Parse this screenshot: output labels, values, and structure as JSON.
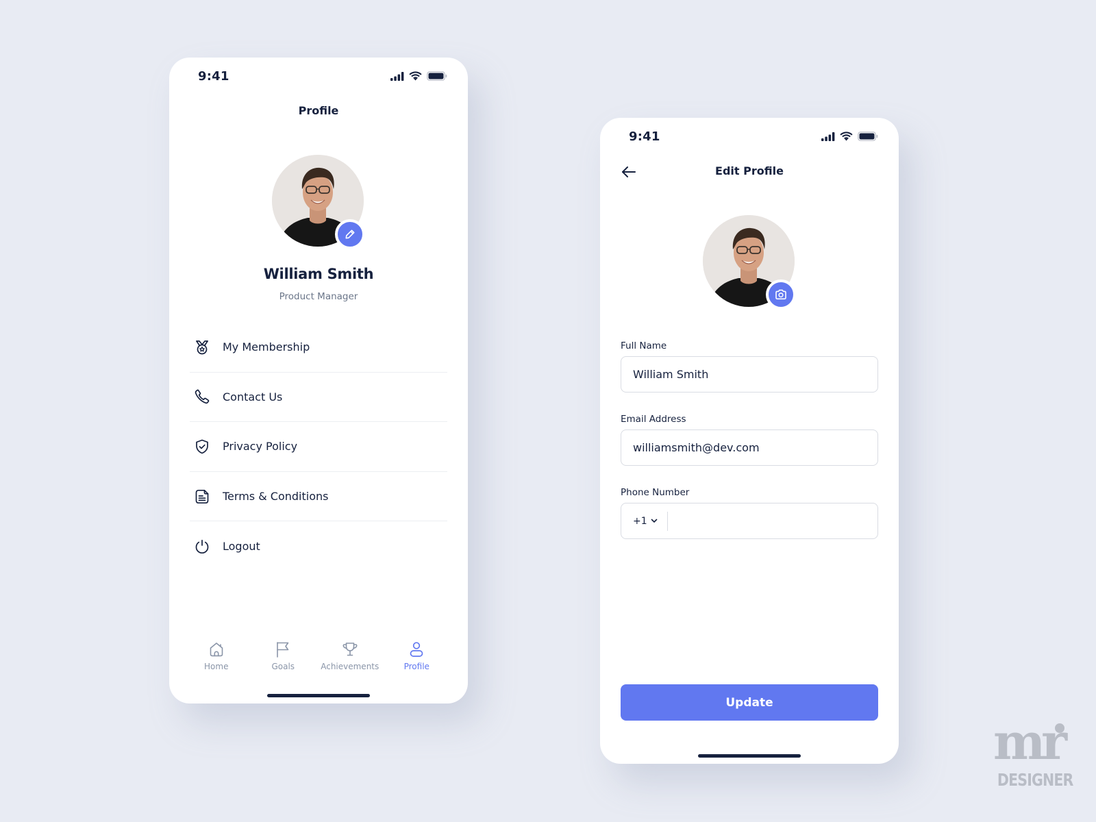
{
  "profile_screen": {
    "status_bar": {
      "time": "9:41"
    },
    "title": "Profile",
    "user": {
      "name": "William Smith",
      "role": "Product Manager"
    },
    "menu": [
      {
        "label": "My Membership",
        "icon": "medal-icon"
      },
      {
        "label": "Contact Us",
        "icon": "phone-icon"
      },
      {
        "label": "Privacy Policy",
        "icon": "shield-check-icon"
      },
      {
        "label": "Terms & Conditions",
        "icon": "document-icon"
      },
      {
        "label": "Logout",
        "icon": "power-icon"
      }
    ],
    "tabbar": [
      {
        "label": "Home",
        "icon": "home-icon",
        "active": false
      },
      {
        "label": "Goals",
        "icon": "flag-icon",
        "active": false
      },
      {
        "label": "Achievements",
        "icon": "trophy-icon",
        "active": false
      },
      {
        "label": "Profile",
        "icon": "user-icon",
        "active": true
      }
    ]
  },
  "edit_profile_screen": {
    "status_bar": {
      "time": "9:41"
    },
    "title": "Edit Profile",
    "fields": {
      "full_name": {
        "label": "Full Name",
        "value": "William Smith"
      },
      "email": {
        "label": "Email Address",
        "value": "williamsmith@dev.com"
      },
      "phone": {
        "label": "Phone Number",
        "country_code": "+1",
        "value": ""
      }
    },
    "update_label": "Update"
  },
  "watermark": {
    "mark": "mr",
    "text": "DESIGNER"
  },
  "colors": {
    "background": "#e8ebf3",
    "accent": "#6178f0",
    "text_primary": "#16213e",
    "text_secondary": "#6b7689",
    "tab_inactive": "#8a95a8",
    "watermark": "#b9bdc6"
  }
}
